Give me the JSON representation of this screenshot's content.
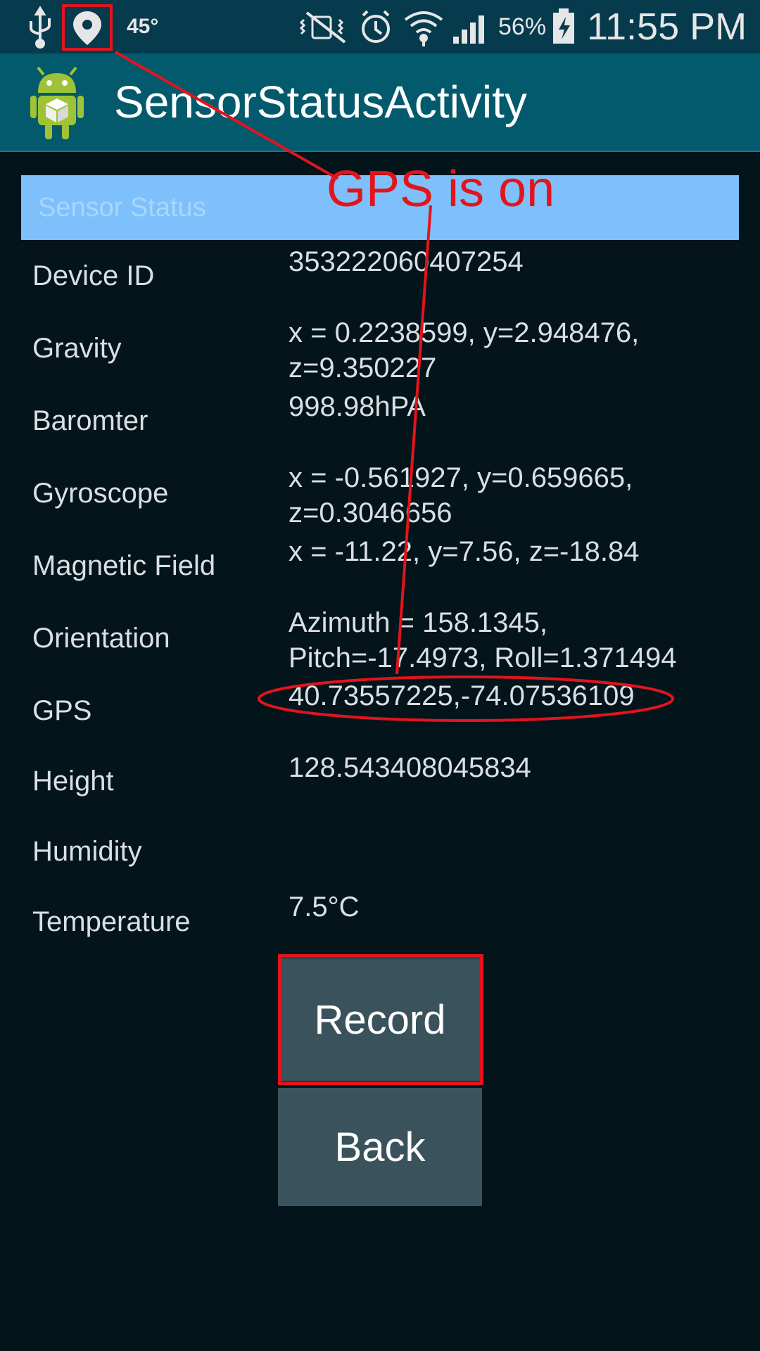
{
  "status_bar": {
    "temperature": "45°",
    "battery_percent": "56%",
    "clock": "11:55 PM",
    "icons": [
      "usb-icon",
      "location-icon",
      "mute-icon",
      "alarm-icon",
      "wifi-icon",
      "signal-icon",
      "battery-charging-icon"
    ]
  },
  "action_bar": {
    "app_icon": "android-app-icon",
    "title": "SensorStatusActivity"
  },
  "section_header": {
    "label": "Sensor Status"
  },
  "sensors": [
    {
      "label": "Device ID",
      "value_lines": [
        "353222060407254"
      ]
    },
    {
      "label": "Gravity",
      "value_lines": [
        "x = 0.2238599, y=2.948476,",
        "z=9.350227"
      ]
    },
    {
      "label": "Baromter",
      "value_lines": [
        "998.98hPA"
      ]
    },
    {
      "label": "Gyroscope",
      "value_lines": [
        "x = -0.561927, y=0.659665,",
        "z=0.3046656"
      ]
    },
    {
      "label": "Magnetic Field",
      "value_lines": [
        "x = -11.22, y=7.56, z=-18.84"
      ]
    },
    {
      "label": "Orientation",
      "value_lines": [
        "Azimuth = 158.1345,",
        "Pitch=-17.4973, Roll=1.371494"
      ]
    },
    {
      "label": "GPS",
      "value_lines": [
        "40.73557225,-74.07536109"
      ]
    },
    {
      "label": "Height",
      "value_lines": [
        "128.543408045834"
      ]
    },
    {
      "label": "Humidity",
      "value_lines": []
    },
    {
      "label": "Temperature",
      "value_lines": [
        "7.5°C"
      ]
    }
  ],
  "buttons": {
    "record": "Record",
    "back": "Back"
  },
  "annotation": {
    "text": "GPS is on",
    "color": "#e3141c"
  },
  "colors": {
    "status_bar": "#063a4d",
    "action_bar": "#045a6d",
    "header": "#7ec0fb",
    "background": "#03141b",
    "button": "#3a525b"
  }
}
